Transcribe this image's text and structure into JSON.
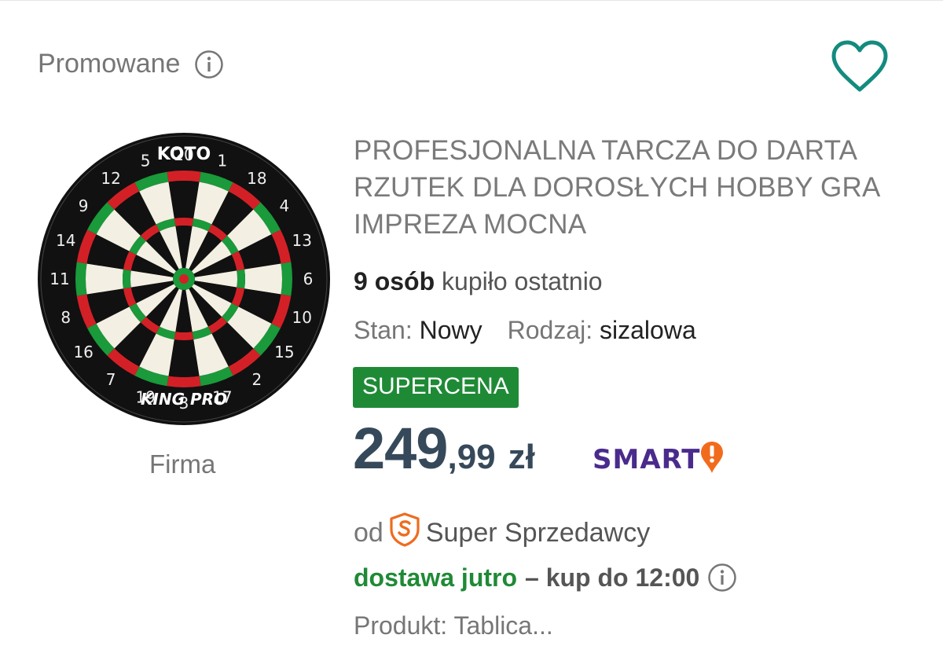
{
  "listing": {
    "promoted_label": "Promowane",
    "title": "PROFESJONALNA TARCZA DO DARTA RZUTEK DLA DOROSŁYCH HOBBY GRA IMPREZA MOCNA",
    "seller_type": "Firma",
    "image": {
      "brand_top": "KOTO",
      "brand_bottom": "KING PRO",
      "numbers": [
        "20",
        "1",
        "18",
        "4",
        "13",
        "6",
        "10",
        "15",
        "2",
        "17",
        "3",
        "19",
        "7",
        "16",
        "8",
        "11",
        "14",
        "9",
        "12",
        "5"
      ]
    },
    "buyers": {
      "count": "9 osób",
      "text": "kupiło ostatnio"
    },
    "params": [
      {
        "label": "Stan:",
        "value": "Nowy"
      },
      {
        "label": "Rodzaj:",
        "value": "sizalowa"
      }
    ],
    "badge": "SUPERCENA",
    "price": {
      "integer": "249",
      "decimal": ",99",
      "currency": "zł"
    },
    "smart_label": "SMART",
    "seller": {
      "prefix": "od",
      "name": "Super Sprzedawcy"
    },
    "delivery": {
      "highlight": "dostawa jutro",
      "rest": "– kup do 12:00"
    },
    "product_line": "Produkt: Tablica..."
  },
  "colors": {
    "accent_teal": "#138b7e",
    "badge_green": "#1f8a36",
    "price_text": "#36495a",
    "smart_purple": "#4a2b8c",
    "smart_orange": "#f26b1d",
    "super_seller_orange": "#ee6c1f"
  },
  "icons": {
    "promo_info": "info-icon",
    "favorite": "heart-outline-icon",
    "smart": "smart-exclamation-icon",
    "super_seller": "super-seller-s-badge-icon",
    "delivery_info": "info-icon"
  }
}
